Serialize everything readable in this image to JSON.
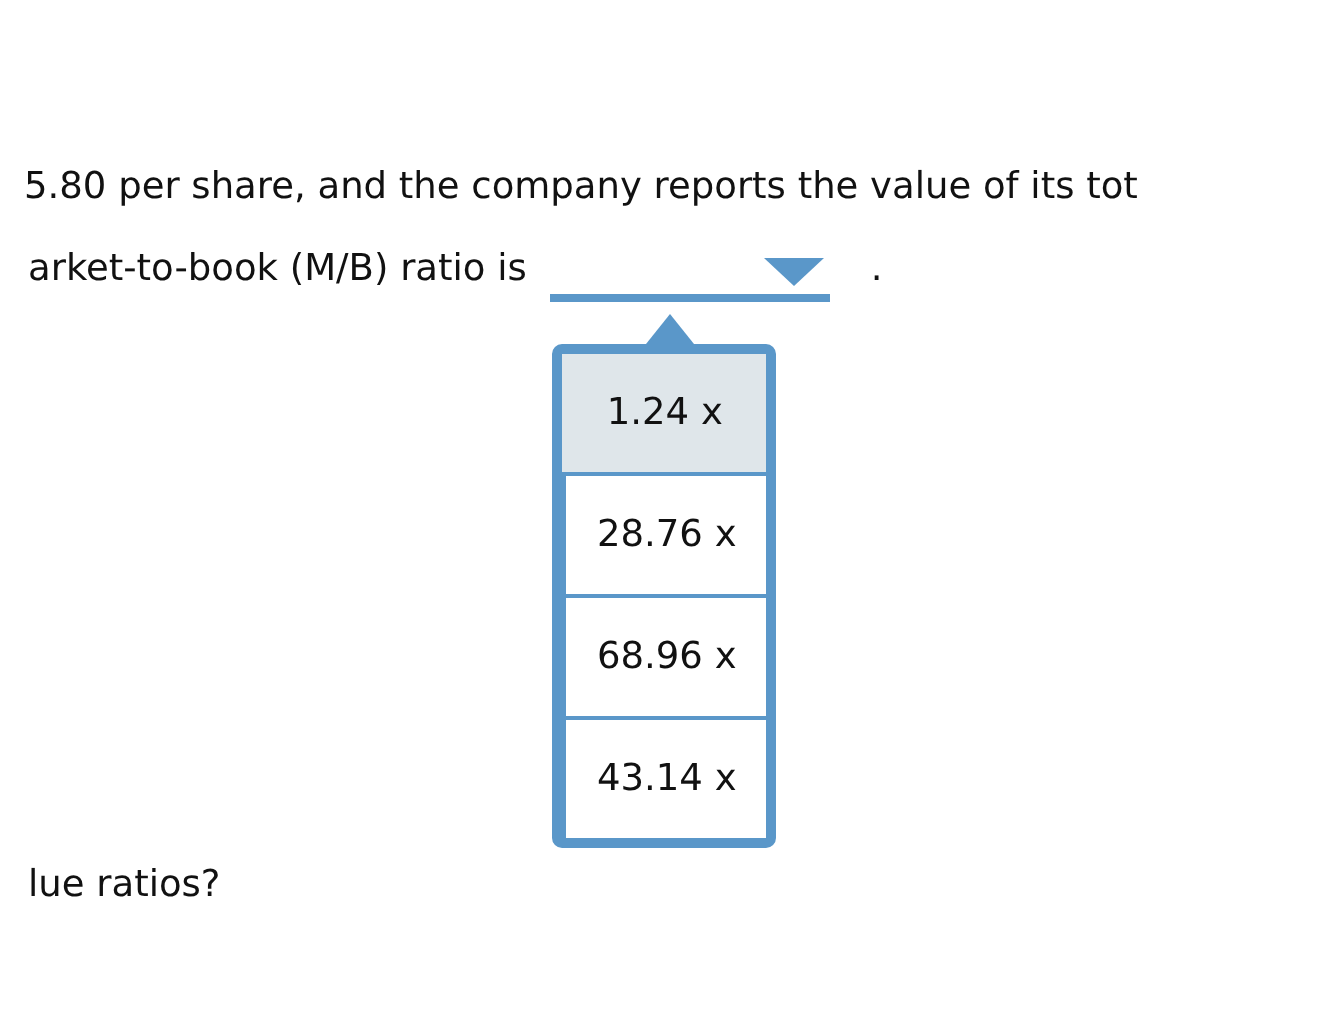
{
  "question": {
    "line_1": "5.80 per share, and the company reports the value of its tot",
    "line_2": "arket-to-book (M/B) ratio is",
    "line_2_end": ".",
    "line_3": "lue ratios?"
  },
  "dropdown": {
    "expanded": true,
    "options": [
      {
        "label": "1.24 x",
        "selected": true
      },
      {
        "label": "28.76 x",
        "selected": false
      },
      {
        "label": "68.96 x",
        "selected": false
      },
      {
        "label": "43.14 x",
        "selected": false
      }
    ]
  }
}
